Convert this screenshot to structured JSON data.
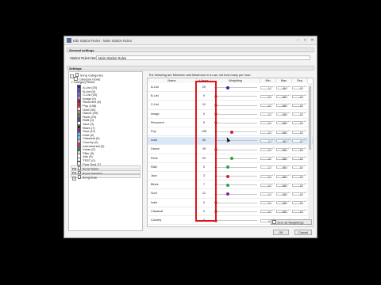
{
  "window": {
    "title": "Edit Station Rules - Main Station Rules"
  },
  "general": {
    "header": "General settings",
    "name_label": "Station Rules Name:",
    "name_value": "Main Station Rules"
  },
  "settings": {
    "header": "Settings"
  },
  "tree": {
    "song_categories": "Song Categories",
    "category_goals": "Category Goals",
    "category_rules": "Category Rules",
    "items": [
      {
        "label": "A-List (20)",
        "color": "#1f2f9c"
      },
      {
        "label": "B-List (9)",
        "color": "#5a3fc6"
      },
      {
        "label": "C-List (10)",
        "color": "#7f63e0"
      },
      {
        "label": "Image (0)",
        "color": "#a87fe8"
      },
      {
        "label": "Recurrent (5)",
        "color": "#a5182b"
      },
      {
        "label": "Pop (198)",
        "color": "#d21f3c"
      },
      {
        "label": "Gold (30)",
        "color": "#e8e4d8"
      },
      {
        "label": "Dance (49)",
        "color": "#f06a8f"
      },
      {
        "label": "Rock (29)",
        "color": "#2fa24a"
      },
      {
        "label": "R&B (0)",
        "color": "#6b3aa0"
      },
      {
        "label": "Jazz (3)",
        "color": "#ffffff"
      },
      {
        "label": "Blues (7)",
        "color": "#1b3b1b"
      },
      {
        "label": "Soul (12)",
        "color": "#8e1fa0"
      },
      {
        "label": "Indie (0)",
        "color": "#5db8e8"
      },
      {
        "label": "Classical (0)",
        "color": "#6ec1ea"
      },
      {
        "label": "Country (0)",
        "color": "#f4a3c6"
      },
      {
        "label": "Instrumental (0)",
        "color": "#c12f9c"
      },
      {
        "label": "Xmas (0)",
        "color": "#2e8b4a"
      },
      {
        "label": "Filler (0)",
        "color": "#d8d8d8"
      },
      {
        "label": "Ads (0)",
        "color": "#ffffff"
      },
      {
        "label": "TEST (0)",
        "color": "#ffffff"
      },
      {
        "label": "Pure Soul (7)",
        "color": "#ffffff"
      }
    ],
    "groups": [
      "Song Types",
      "Song Genders",
      "Song Eras"
    ]
  },
  "grid": {
    "info": "The following are Minimum and Maximum in a row, not how many per hour:",
    "headers": {
      "name": "Name",
      "items": "# Items",
      "weighting": "Weighting",
      "min": "Min",
      "max": "Max",
      "sep": "Sep"
    },
    "rows": [
      {
        "name": "A-List",
        "items": "20",
        "min": "1",
        "max": "99",
        "sep": "0",
        "knob": 0.3,
        "color": "#1f2f9c"
      },
      {
        "name": "B-List",
        "items": "9",
        "min": "1",
        "max": "99",
        "sep": "0",
        "knob": 0.0,
        "color": "#9a9a9a"
      },
      {
        "name": "C-List",
        "items": "10",
        "min": "1",
        "max": "99",
        "sep": "0",
        "knob": 0.0,
        "color": "#9a9a9a"
      },
      {
        "name": "Image",
        "items": "0",
        "min": "1",
        "max": "99",
        "sep": "0",
        "knob": 0.0,
        "color": "#9a9a9a"
      },
      {
        "name": "Recurrent",
        "items": "5",
        "min": "1",
        "max": "99",
        "sep": "0",
        "knob": 0.0,
        "color": "#9a9a9a"
      },
      {
        "name": "Pop",
        "items": "198",
        "min": "1",
        "max": "99",
        "sep": "0",
        "knob": 0.4,
        "color": "#d21f3c"
      },
      {
        "name": "Gold",
        "items": "30",
        "min": "1",
        "max": "99",
        "sep": "0",
        "knob": 0.3,
        "color": "#c0c0c0"
      },
      {
        "name": "Dance",
        "items": "49",
        "min": "1",
        "max": "99",
        "sep": "0",
        "knob": 0.0,
        "color": "#9a9a9a"
      },
      {
        "name": "Rock",
        "items": "29",
        "min": "1",
        "max": "99",
        "sep": "0",
        "knob": 0.4,
        "color": "#2fa24a"
      },
      {
        "name": "R&B",
        "items": "0",
        "min": "1",
        "max": "99",
        "sep": "0",
        "knob": 0.3,
        "color": "#2fa24a"
      },
      {
        "name": "Jazz",
        "items": "3",
        "min": "1",
        "max": "99",
        "sep": "0",
        "knob": 0.3,
        "color": "#d21f3c"
      },
      {
        "name": "Blues",
        "items": "7",
        "min": "1",
        "max": "99",
        "sep": "0",
        "knob": 0.3,
        "color": "#2fa24a"
      },
      {
        "name": "Soul",
        "items": "12",
        "min": "1",
        "max": "99",
        "sep": "0",
        "knob": 0.3,
        "color": "#8e1fa0"
      },
      {
        "name": "Indie",
        "items": "0",
        "min": "1",
        "max": "99",
        "sep": "0",
        "knob": 0.0,
        "color": "#9a9a9a"
      },
      {
        "name": "Classical",
        "items": "0",
        "min": "1",
        "max": "99",
        "sep": "0",
        "knob": 0.0,
        "color": "#9a9a9a"
      },
      {
        "name": "Country",
        "items": "0",
        "min": "1",
        "max": "99",
        "sep": "0",
        "knob": 0.0,
        "color": "#9a9a9a"
      }
    ],
    "selected_row": 6
  },
  "buttons": {
    "zero_all": "Zero all Weightings",
    "ok": "OK",
    "cancel": "Cancel"
  }
}
